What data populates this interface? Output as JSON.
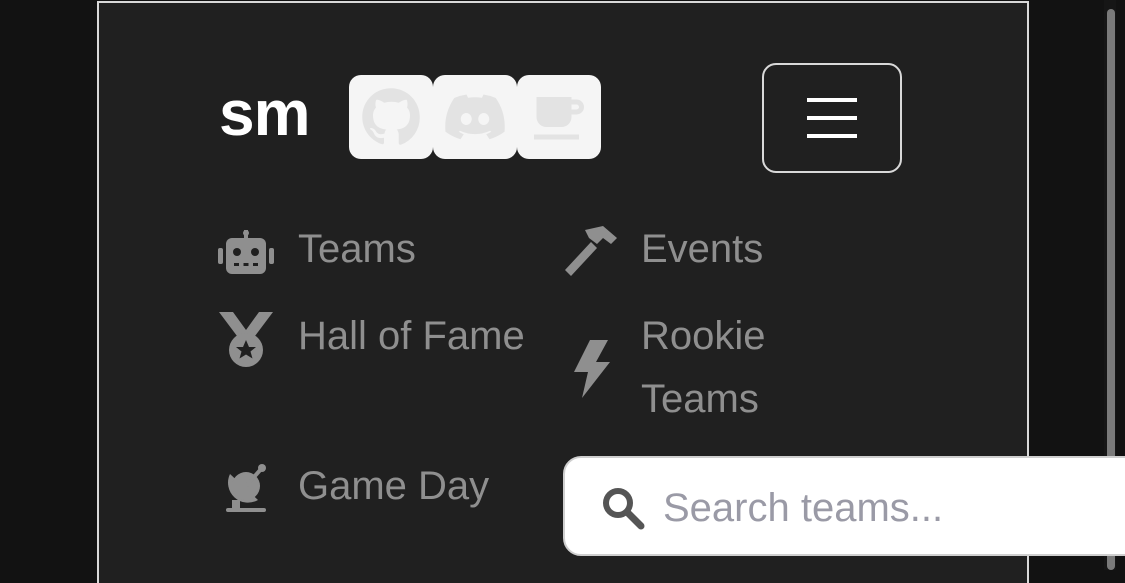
{
  "header": {
    "logo": "sm",
    "social": [
      {
        "name": "github",
        "icon": "github-icon"
      },
      {
        "name": "discord",
        "icon": "discord-icon"
      },
      {
        "name": "coffee",
        "icon": "coffee-icon"
      }
    ],
    "menu_icon": "hamburger-icon"
  },
  "nav": {
    "teams": {
      "label": "Teams",
      "icon": "robot-icon"
    },
    "events": {
      "label": "Events",
      "icon": "hammer-icon"
    },
    "hall_of_fame": {
      "label": "Hall of Fame",
      "icon": "medal-icon"
    },
    "rookie_teams": {
      "label_line1": "Rookie",
      "label_line2": "Teams",
      "icon": "bolt-icon"
    },
    "game_day": {
      "label": "Game Day",
      "icon": "satellite-dish-icon"
    }
  },
  "search": {
    "placeholder": "Search teams...",
    "value": "",
    "icon": "search-icon"
  },
  "colors": {
    "panel_bg": "#202020",
    "page_bg": "#121212",
    "nav_text": "#8f8f8f",
    "logo_text": "#ffffff"
  }
}
